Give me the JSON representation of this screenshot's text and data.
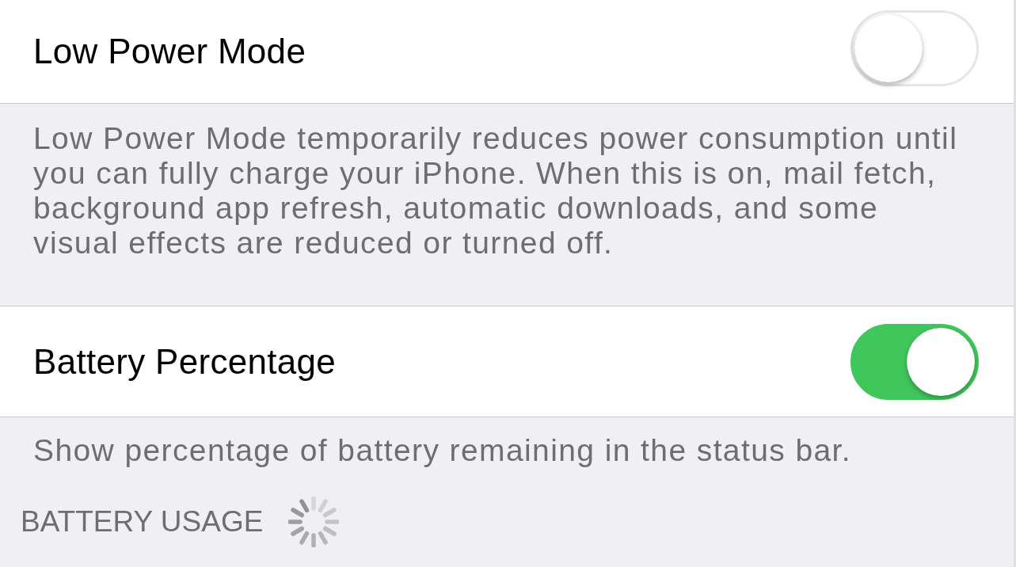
{
  "sections": [
    {
      "rows": [
        {
          "label": "Low Power Mode",
          "kind": "toggle",
          "on": false
        }
      ],
      "footer": "Low Power Mode temporarily reduces power consumption until you can fully charge your iPhone. When this is on, mail fetch, background app refresh, automatic downloads, and some visual effects are reduced or turned off."
    },
    {
      "rows": [
        {
          "label": "Battery Percentage",
          "kind": "toggle",
          "on": true
        }
      ],
      "footer": "Show percentage of battery remaining in the status bar."
    },
    {
      "header": "BATTERY USAGE",
      "loading": true
    }
  ]
}
